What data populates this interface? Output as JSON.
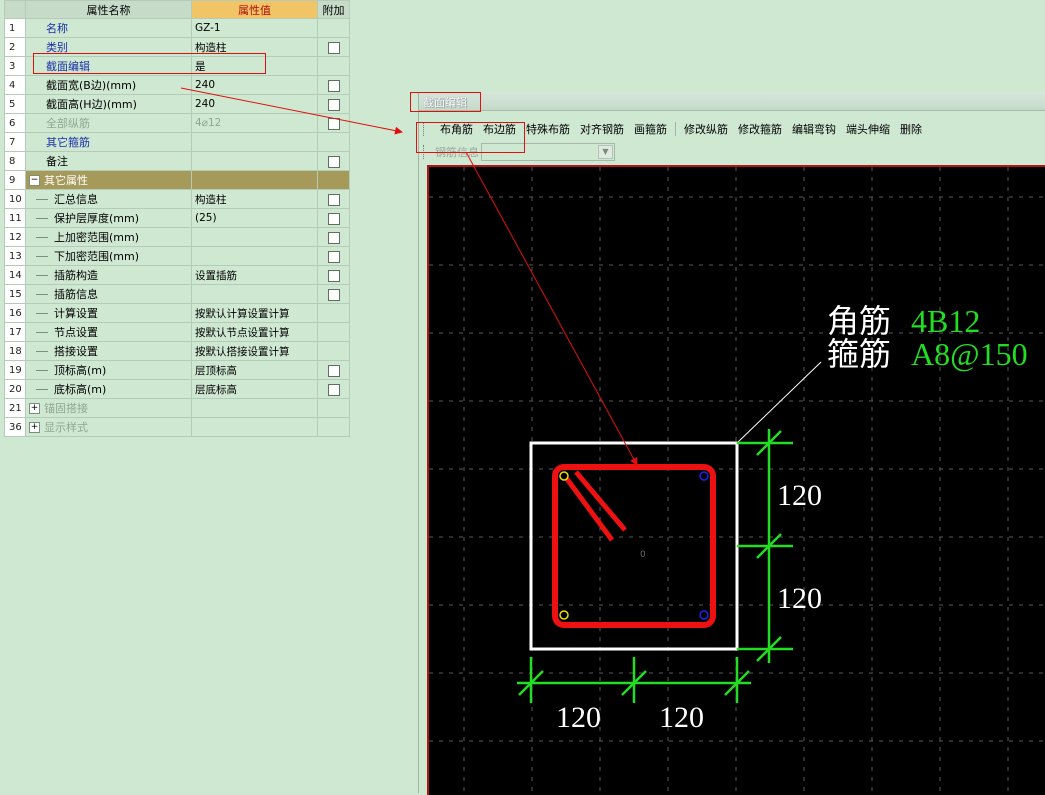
{
  "grid": {
    "headers": {
      "name": "属性名称",
      "value": "属性值",
      "extra": "附加"
    },
    "rows": [
      {
        "num": "1",
        "name": "名称",
        "value": "GZ-1",
        "checkbox": false,
        "style": "blue",
        "level": 0
      },
      {
        "num": "2",
        "name": "类别",
        "value": "构造柱",
        "checkbox": true,
        "style": "blue",
        "level": 0
      },
      {
        "num": "3",
        "name": "截面编辑",
        "value": "是",
        "checkbox": false,
        "style": "blue",
        "level": 0
      },
      {
        "num": "4",
        "name": "截面宽(B边)(mm)",
        "value": "240",
        "checkbox": true,
        "style": "normal",
        "level": 0
      },
      {
        "num": "5",
        "name": "截面高(H边)(mm)",
        "value": "240",
        "checkbox": true,
        "style": "normal",
        "level": 0
      },
      {
        "num": "6",
        "name": "全部纵筋",
        "value": "4⌀12",
        "checkbox": true,
        "style": "gray",
        "level": 0
      },
      {
        "num": "7",
        "name": "其它箍筋",
        "value": "",
        "checkbox": false,
        "style": "blue",
        "level": 0
      },
      {
        "num": "8",
        "name": "备注",
        "value": "",
        "checkbox": true,
        "style": "normal",
        "level": 0
      },
      {
        "num": "9",
        "name": "其它属性",
        "value": "",
        "checkbox": false,
        "style": "group",
        "level": 0,
        "toggle": "−",
        "selected": true
      },
      {
        "num": "10",
        "name": "汇总信息",
        "value": "构造柱",
        "checkbox": true,
        "style": "normal",
        "level": 1
      },
      {
        "num": "11",
        "name": "保护层厚度(mm)",
        "value": "(25)",
        "checkbox": true,
        "style": "normal",
        "level": 1
      },
      {
        "num": "12",
        "name": "上加密范围(mm)",
        "value": "",
        "checkbox": true,
        "style": "normal",
        "level": 1
      },
      {
        "num": "13",
        "name": "下加密范围(mm)",
        "value": "",
        "checkbox": true,
        "style": "normal",
        "level": 1
      },
      {
        "num": "14",
        "name": "插筋构造",
        "value": "设置插筋",
        "checkbox": true,
        "style": "normal",
        "level": 1
      },
      {
        "num": "15",
        "name": "插筋信息",
        "value": "",
        "checkbox": true,
        "style": "normal",
        "level": 1
      },
      {
        "num": "16",
        "name": "计算设置",
        "value": "按默认计算设置计算",
        "checkbox": false,
        "style": "normal",
        "level": 1
      },
      {
        "num": "17",
        "name": "节点设置",
        "value": "按默认节点设置计算",
        "checkbox": false,
        "style": "normal",
        "level": 1
      },
      {
        "num": "18",
        "name": "搭接设置",
        "value": "按默认搭接设置计算",
        "checkbox": false,
        "style": "normal",
        "level": 1
      },
      {
        "num": "19",
        "name": "顶标高(m)",
        "value": "层顶标高",
        "checkbox": true,
        "style": "normal",
        "level": 1
      },
      {
        "num": "20",
        "name": "底标高(m)",
        "value": "层底标高",
        "checkbox": true,
        "style": "normal",
        "level": 1
      },
      {
        "num": "21",
        "name": "锚固搭接",
        "value": "",
        "checkbox": false,
        "style": "gray",
        "level": 0,
        "toggle": "+"
      },
      {
        "num": "36",
        "name": "显示样式",
        "value": "",
        "checkbox": false,
        "style": "gray",
        "level": 0,
        "toggle": "+"
      }
    ]
  },
  "editor": {
    "title": "截面编辑",
    "toolbar": [
      "布角筋",
      "布边筋",
      "特殊布筋",
      "对齐钢筋",
      "画箍筋",
      "|",
      "修改纵筋",
      "修改箍筋",
      "编辑弯钩",
      "端头伸缩",
      "删除"
    ],
    "rebar_info_label": "钢筋信息",
    "rebar_info_value": ""
  },
  "drawing": {
    "corner_label": "角筋",
    "corner_value": "4B12",
    "stirrup_label": "箍筋",
    "stirrup_value": "A8@150",
    "dims_right": [
      "120",
      "120"
    ],
    "dims_bottom": [
      "120",
      "120"
    ],
    "center_mark": "0",
    "colors": {
      "background": "#000000",
      "grid": "#5a5a5a",
      "outline": "#ffffff",
      "stirrup": "#ee1111",
      "dimension": "#22dd22",
      "value_text": "#22dd22",
      "label_text": "#ffffff",
      "corner_bar_yellow": "#e8e000",
      "corner_bar_blue": "#2222ee"
    }
  }
}
